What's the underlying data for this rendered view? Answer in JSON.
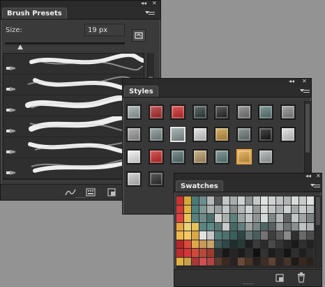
{
  "brush_presets": {
    "title": "Brush Presets",
    "size_label": "Size:",
    "size_value": "19 px",
    "slider_value": 0.08,
    "brushes": [
      {
        "icon": "brush-tip-icon"
      },
      {
        "icon": "brush-tip-icon"
      },
      {
        "icon": "brush-tip-icon"
      },
      {
        "icon": "brush-tip-icon"
      },
      {
        "icon": "airbrush-icon"
      },
      {
        "icon": "brush-tip-icon"
      }
    ],
    "footer_icons": [
      "toggle-brush-panel-icon",
      "create-new-preset-icon",
      "delete-preset-icon"
    ]
  },
  "styles": {
    "title": "Styles",
    "swatches": [
      [
        "#9aa8a6",
        "#b22a2a",
        "#d52828",
        "#2e3b3a",
        "#262626",
        "#7c7c7c",
        "#5a7b79",
        "#8b8b8b"
      ],
      [
        "#9b9b9b",
        "#7e8f8d",
        "#8fa09e",
        "#dedede",
        "#c79a3d",
        "#6c7a78",
        "#111111",
        "#dcdcdc"
      ],
      [
        "#f4f4f4",
        "#cc2727",
        "#557372",
        "#b99b66",
        "#5f7f7d",
        "#e0a33c",
        "#a9aeae"
      ],
      [
        "#c9c9c9",
        "#2a2a2a"
      ]
    ],
    "selected": "1-2",
    "highlighted": "2-5"
  },
  "swatches_panel": {
    "title": "Swatches",
    "rows": [
      [
        "#c83232",
        "#d6a838",
        "#4a7a78",
        "#6d8e8c",
        "#b7bbbb",
        "#585858",
        "#c3c6c6",
        "#a8acac",
        "#d0d3d3",
        "#8d9191",
        "#c5c8c8",
        "#e0e2e2",
        "#cfd2d2",
        "#bfc2c2",
        "#b0b4b4",
        "#d9dbdb",
        "#c8cbcb",
        "#dfe1e1"
      ],
      [
        "#d63a3a",
        "#e0b240",
        "#4f807e",
        "#7f9896",
        "#acb1b1",
        "#9aa0a0",
        "#c2c6c6",
        "#888c8c",
        "#b3b7b7",
        "#cfd2d2",
        "#969a9a",
        "#d7d9d9",
        "#c1c4c4",
        "#abafaf",
        "#cdd0d0",
        "#a4a8a8",
        "#c9cccc",
        "#b9bcbc"
      ],
      [
        "#e24141",
        "#e8c25a",
        "#57817f",
        "#6f8a88",
        "#4e6e6d",
        "#cfcfcf",
        "#aab0b0",
        "#5d7f7d",
        "#9ea4a4",
        "#bfc3c3",
        "#8f9595",
        "#d5d8d8",
        "#7e8686",
        "#b7bbbb",
        "#5e6464",
        "#c3c6c6",
        "#a0a4a4",
        "#7d8181"
      ],
      [
        "#e9a63e",
        "#ecd27a",
        "#e7c05a",
        "#5b8482",
        "#5d8a88",
        "#5b7674",
        "#cacaca",
        "#496866",
        "#5f7e7c",
        "#9aa0a0",
        "#7a8686",
        "#4e6766",
        "#595f5f",
        "#9b9f9f",
        "#6f7474",
        "#8a8e8e",
        "#bfc2c2",
        "#adb1b1"
      ],
      [
        "#f0b84a",
        "#f5c963",
        "#d9a84a",
        "#e1e1e1",
        "#c7c7c7",
        "#527a78",
        "#4f6f6d",
        "#3b5f5d",
        "#2e4746",
        "#627574",
        "#4a5e5d",
        "#737373",
        "#3e3e3e",
        "#5b5b5b",
        "#8a8a8a",
        "#2f2f2f",
        "#6a6a6a",
        "#4c4c4c"
      ],
      [
        "#b82626",
        "#dc4a3a",
        "#e1a64b",
        "#c79a58",
        "#c6a36b",
        "#3d5a58",
        "#2f4746",
        "#1f2e2d",
        "#283a39",
        "#1e1e1e",
        "#3a3a3a",
        "#2b2b2b",
        "#4a4a4a",
        "#353535",
        "#262626",
        "#1a1a1a",
        "#303030",
        "#222222"
      ],
      [
        "#c22b2b",
        "#d83434",
        "#cf4a3a",
        "#b54a3a",
        "#9d3a2e",
        "#2d2d2d",
        "#171717",
        "#242424",
        "#1b1b1b",
        "#2a2a2a",
        "#101010",
        "#333333",
        "#1c1c1c",
        "#262626",
        "#141414",
        "#2e2e2e",
        "#1f1f1f",
        "#2b2b2b"
      ],
      [
        "#e0b040",
        "#c9a04a",
        "#a83838",
        "#d05050",
        "#b24444",
        "#5a3a2a",
        "#3a2a22",
        "#2a2220",
        "#6a4a3a",
        "#4a3428",
        "#24201e",
        "#3e2e26",
        "#5e4234",
        "#2c2420",
        "#46342a",
        "#1e1a18",
        "#38281f",
        "#2a201c"
      ]
    ],
    "footer_icons": [
      "new-swatch-icon",
      "delete-swatch-icon"
    ]
  }
}
